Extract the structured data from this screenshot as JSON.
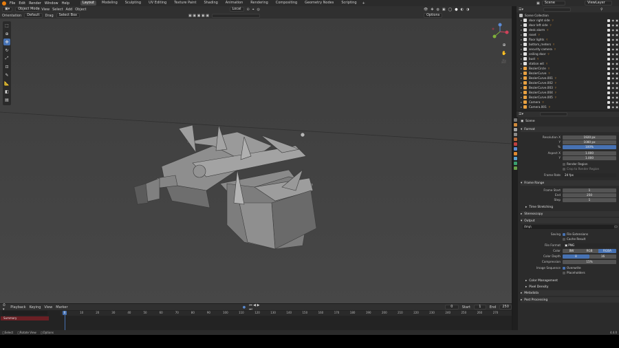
{
  "menu": {
    "items": [
      "File",
      "Edit",
      "Render",
      "Window",
      "Help"
    ],
    "workspaces": [
      "Layout",
      "Modeling",
      "Sculpting",
      "UV Editing",
      "Texture Paint",
      "Shading",
      "Animation",
      "Rendering",
      "Compositing",
      "Geometry Nodes",
      "Scripting"
    ],
    "active_workspace": "Layout",
    "scene": "Scene",
    "view_layer": "ViewLayer"
  },
  "viewport_header": {
    "mode": "Object Mode",
    "menus": [
      "View",
      "Select",
      "Add",
      "Object"
    ],
    "transform": "Local",
    "options_label": "Options"
  },
  "tool_header": {
    "orientation_label": "Orientation",
    "orientation_value": "Default",
    "drag_label": "Drag",
    "drag_value": "Select Box"
  },
  "outliner": {
    "title": "Scene Collection",
    "search_placeholder": "",
    "rows": [
      {
        "name": "door right side",
        "color": "#e0e0e0",
        "type": "mesh"
      },
      {
        "name": "door left side",
        "color": "#e0e0e0",
        "type": "mesh"
      },
      {
        "name": "desk alarm",
        "color": "#e0e0e0",
        "type": "mesh"
      },
      {
        "name": "roset",
        "color": "#e0e0e0",
        "type": "mesh"
      },
      {
        "name": "floor lights",
        "color": "#e0e0e0",
        "type": "mesh"
      },
      {
        "name": "bottom_meters",
        "color": "#e0e0e0",
        "type": "mesh"
      },
      {
        "name": "security camera",
        "color": "#e0e0e0",
        "type": "mesh"
      },
      {
        "name": "ceiling door",
        "color": "#e0e0e0",
        "type": "mesh"
      },
      {
        "name": "bust",
        "color": "#e0e0e0",
        "type": "mesh"
      },
      {
        "name": "station wit",
        "color": "#e0e0e0",
        "type": "mesh"
      },
      {
        "name": "BezierCircle",
        "color": "#e8a040",
        "type": "curve"
      },
      {
        "name": "BezierCurve",
        "color": "#e8a040",
        "type": "curve"
      },
      {
        "name": "BezierCurve.001",
        "color": "#e8a040",
        "type": "curve"
      },
      {
        "name": "BezierCurve.002",
        "color": "#e8a040",
        "type": "curve"
      },
      {
        "name": "BezierCurve.003",
        "color": "#e8a040",
        "type": "curve"
      },
      {
        "name": "BezierCurve.004",
        "color": "#e8a040",
        "type": "curve"
      },
      {
        "name": "BezierCurve.005",
        "color": "#e8a040",
        "type": "curve"
      },
      {
        "name": "Camera",
        "color": "#e8a040",
        "type": "camera"
      },
      {
        "name": "Camera.001",
        "color": "#e8a040",
        "type": "camera"
      }
    ]
  },
  "properties": {
    "context": "Scene",
    "format_title": "Format",
    "resolution_x_label": "Resolution X",
    "resolution_x": "1920 px",
    "resolution_y_label": "Y",
    "resolution_y": "1080 px",
    "resolution_pct_label": "%",
    "resolution_pct": "100%",
    "aspect_x_label": "Aspect X",
    "aspect_x": "1.000",
    "aspect_y_label": "Y",
    "aspect_y": "1.000",
    "render_region": "Render Region",
    "crop_region": "Crop to Render Region",
    "frame_rate_label": "Frame Rate",
    "frame_rate": "24 fps",
    "frame_range_title": "Frame Range",
    "frame_start_label": "Frame Start",
    "frame_start": "1",
    "end_label": "End",
    "end": "250",
    "step_label": "Step",
    "step": "1",
    "time_stretching": "Time Stretching",
    "stereoscopy": "Stereoscopy",
    "output_title": "Output",
    "output_path": "/tmp\\",
    "saving_label": "Saving",
    "file_extensions": "File Extensions",
    "cache_result": "Cache Result",
    "file_format_label": "File Format",
    "file_format": "PNG",
    "color_label": "Color",
    "color_options": [
      "BW",
      "RGB",
      "RGBA"
    ],
    "color_active": "RGBA",
    "color_depth_label": "Color Depth",
    "color_depth_options": [
      "8",
      "16"
    ],
    "compression_label": "Compression",
    "compression": "15%",
    "image_sequence_label": "Image Sequence",
    "overwrite": "Overwrite",
    "placeholders": "Placeholders",
    "color_management": "Color Management",
    "pixel_density": "Pixel Density",
    "metadata": "Metadata",
    "post_processing": "Post Processing"
  },
  "timeline": {
    "menus": [
      "Playback",
      "Keying",
      "View",
      "Marker"
    ],
    "current_frame": "0",
    "start_label": "Start",
    "start": "1",
    "end_label": "End",
    "end": "250",
    "summary": "Summary",
    "ticks": [
      "0",
      "10",
      "20",
      "30",
      "40",
      "50",
      "60",
      "70",
      "80",
      "90",
      "100",
      "110",
      "120",
      "130",
      "140",
      "150",
      "160",
      "170",
      "180",
      "190",
      "200",
      "210",
      "220",
      "230",
      "240",
      "250",
      "260",
      "270"
    ]
  },
  "status": {
    "items": [
      "Select",
      "Rotate View",
      "Options"
    ],
    "version": "4.4.0"
  },
  "colors": {
    "accent": "#4772b3",
    "orange": "#e87d0d"
  }
}
